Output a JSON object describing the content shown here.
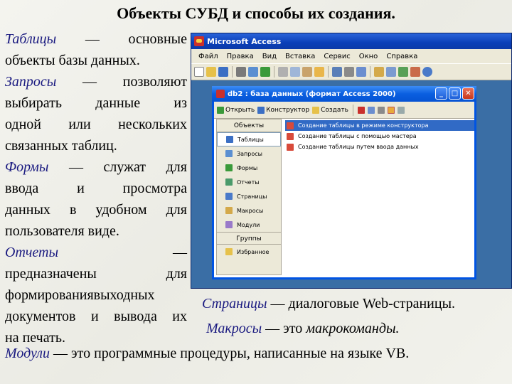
{
  "title": "Объекты СУБД и способы их создания.",
  "left": {
    "p1_term": "Таблицы",
    "p1_dash": "—",
    "p1_first": "основные",
    "p1_rest": "объекты базы данных.",
    "p2_term": "Запросы",
    "p2_dash": "—",
    "p2_first": "позволяют",
    "p2_line2a": "выбирать",
    "p2_line2b": "данные",
    "p2_line2c": "из",
    "p2_line3a": "одной",
    "p2_line3b": "или",
    "p2_line3c": "нескольких",
    "p2_rest": "связанных таблиц.",
    "p3_term": "Формы",
    "p3_dash": "—",
    "p3_first1": "служат",
    "p3_first2": "для",
    "p3_l2a": "ввода",
    "p3_l2b": "и",
    "p3_l2c": "просмотра",
    "p3_l3a": "данных",
    "p3_l3b": "в",
    "p3_l3c": "удобном",
    "p3_l3d": "для",
    "p3_rest": "пользователя виде.",
    "p4_term": "Отчеты",
    "p4_dash": "—",
    "p4_l2a": "предназначены",
    "p4_l2b": "для",
    "p4_l3": "формированиявыходных",
    "p4_l4a": "документов",
    "p4_l4b": "и",
    "p4_l4c": "вывода",
    "p4_l4d": "их",
    "p4_l5": "на печать."
  },
  "right": {
    "pages_term": "Страницы",
    "pages_text": " — диалоговые Web-страницы.",
    "macros_term": "Макросы",
    "macros_text": " — это",
    "macros_tail": " макрокоманды."
  },
  "bottom": {
    "modules_term": "Модули",
    "modules_text": " — это программные процедуры, написанные на языке VB."
  },
  "access": {
    "window_title": "Microsoft Access",
    "menu": [
      "Файл",
      "Правка",
      "Вид",
      "Вставка",
      "Сервис",
      "Окно",
      "Справка"
    ]
  },
  "db": {
    "window_title": "db2 : база данных (формат Access 2000)",
    "toolbar": [
      "Открыть",
      "Конструктор",
      "Создать"
    ],
    "sidebar_header": "Объекты",
    "sidebar_items": [
      "Таблицы",
      "Запросы",
      "Формы",
      "Отчеты",
      "Страницы",
      "Макросы",
      "Модули"
    ],
    "groups_header": "Группы",
    "groups_items": [
      "Избранное"
    ],
    "list": [
      "Создание таблицы в режиме конструктора",
      "Создание таблицы с помощью мастера",
      "Создание таблицы путем ввода данных"
    ]
  },
  "colors": {
    "term": "#1a1a80",
    "xp_blue": "#0054e3",
    "desktop": "#3a6ea5"
  }
}
